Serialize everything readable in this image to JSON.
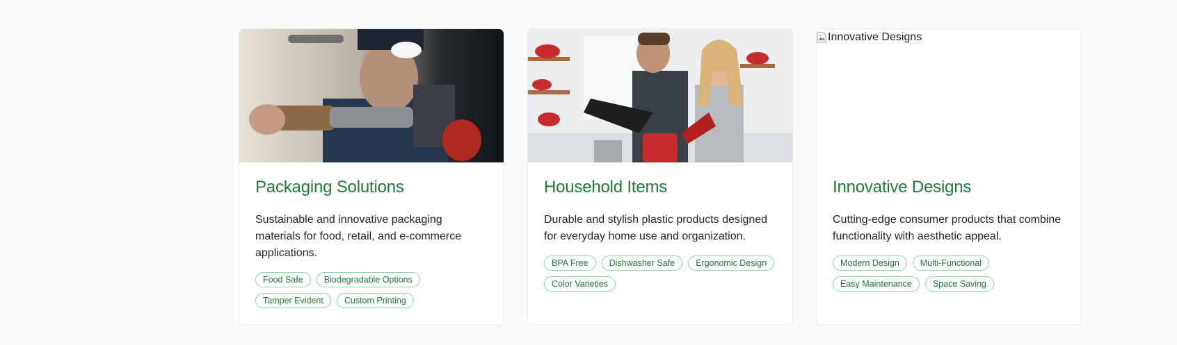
{
  "cards": [
    {
      "title": "Packaging Solutions",
      "description": "Sustainable and innovative packaging materials for food, retail, and e-commerce applications.",
      "image_alt": "Packaging Solutions",
      "image_state": "loaded",
      "tags": [
        "Food Safe",
        "Biodegradable Options",
        "Tamper Evident",
        "Custom Printing"
      ]
    },
    {
      "title": "Household Items",
      "description": "Durable and stylish plastic products designed for everyday home use and organization.",
      "image_alt": "Household Items",
      "image_state": "loaded",
      "tags": [
        "BPA Free",
        "Dishwasher Safe",
        "Ergonomic Design",
        "Color Varieties"
      ]
    },
    {
      "title": "Innovative Designs",
      "description": "Cutting-edge consumer products that combine functionality with aesthetic appeal.",
      "image_alt": "Innovative Designs",
      "image_state": "broken",
      "tags": [
        "Modern Design",
        "Multi-Functional",
        "Easy Maintenance",
        "Space Saving"
      ]
    }
  ],
  "colors": {
    "accent": "#1e7a3c",
    "tag_border": "#8fd6a8",
    "page_background": "#f8fafc"
  }
}
